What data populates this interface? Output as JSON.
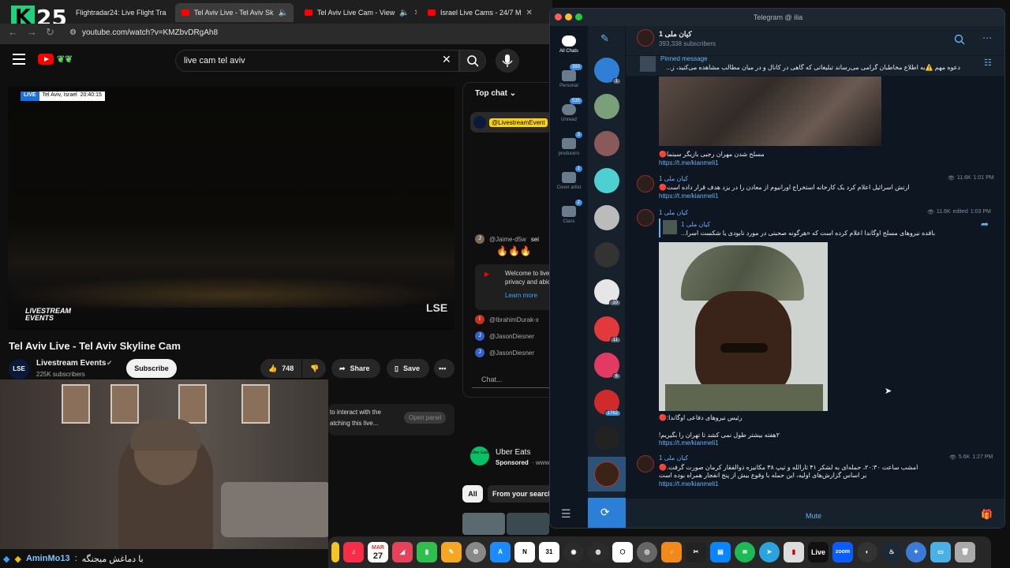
{
  "browser": {
    "counter": {
      "letter": "K",
      "number": "25"
    },
    "tabs": [
      {
        "label": "Flightradar24: Live Flight Tra",
        "active": false
      },
      {
        "label": "Tel Aviv Live - Tel Aviv Sk",
        "active": true
      },
      {
        "label": "Tel Aviv Live Cam - View",
        "active": false
      },
      {
        "label": "Israel Live Cams - 24/7 M",
        "active": false
      }
    ],
    "url": "youtube.com/watch?v=KMZbvDRgAh8"
  },
  "youtube": {
    "search": {
      "value": "live cam tel aviv"
    },
    "live_badge": "LIVE",
    "live_location": "Tel Aviv, Israel",
    "live_time": "20:40:15",
    "video_overlay_logo": "LIVESTREAM EVENTS",
    "video_corner_logo": "LSE",
    "video_title": "Tel Aviv Live - Tel Aviv Skyline Cam",
    "channel": {
      "avatar_text": "LSE",
      "name": "Livestream Events",
      "subscribers": "225K subscribers"
    },
    "subscribe_label": "Subscribe",
    "like_count": "748",
    "share_label": "Share",
    "save_label": "Save",
    "chat": {
      "header": "Top chat",
      "pinned_user": "@LivestreamEvent",
      "messages": [
        {
          "user": "@Jaime-d5w",
          "text": "sei",
          "avatar": "J",
          "color": "#7a6a5a"
        },
        {
          "user": "@IbrahimDurak-x",
          "text": "",
          "avatar": "I",
          "color": "#c2341f"
        },
        {
          "user": "@JasonDiesner",
          "text": "",
          "avatar": "J",
          "color": "#3461c9"
        },
        {
          "user": "@JasonDiesner",
          "text": "",
          "avatar": "J",
          "color": "#3461c9"
        }
      ],
      "welcome_text": "Welcome to live privacy and abic",
      "learn_more": "Learn more",
      "input_placeholder": "Chat...",
      "interact_text_1": "to interact with the",
      "interact_text_2": "atching this live...",
      "open_panel": "Open panel"
    },
    "ad": {
      "title": "Uber Eats",
      "sponsored": "Sponsored",
      "dots": "· www.",
      "logo_text": "Uber Eats"
    },
    "filters": {
      "all": "All",
      "from_search": "From your search"
    }
  },
  "stream_banner": {
    "user": "AminMo13",
    "separator": ":",
    "text": "با دماغش میجنگه"
  },
  "telegram": {
    "window_title": "Telegram @ ilia",
    "folders": [
      {
        "label": "All Chats",
        "badge": ""
      },
      {
        "label": "Personal",
        "badge": "393"
      },
      {
        "label": "Unread",
        "badge": "535"
      },
      {
        "label": "producers",
        "badge": "3"
      },
      {
        "label": "Cover artist",
        "badge": "1"
      },
      {
        "label": "Class",
        "badge": "2"
      }
    ],
    "chat_badges": [
      "1",
      "10",
      "11",
      "6",
      "1762"
    ],
    "channel": {
      "name": "کیان ملی 1",
      "subscribers": "393,338 subscribers"
    },
    "pinned": {
      "label": "Pinned message",
      "text": "دعوه مهم ⚠️به اطلاع مخاطبان گرامی می‌رساند تبلیغاتی که گاهی در کانال و در میان مطالب مشاهده می‌کنید، ز..."
    },
    "messages": [
      {
        "caption": "مسلح شدن مهران رجبی بازیگر سینما🔴",
        "link": "https://t.me/kianmeli1"
      },
      {
        "sender": "کیان ملی 1",
        "text": "ارتش اسرائیل اعلام کرد یک کارخانه استخراج اورانیوم از معادن را در یزد هدف قرار داده است🔴",
        "link": "https://t.me/kianmeli1",
        "views": "11.6K",
        "time": "1:01 PM"
      },
      {
        "sender": "کیان ملی 1",
        "reply_sender": "کیان ملی 1",
        "reply_text": "باقده نیروهای مسلح اوگاندا اعلام کرده است که «هرگونه صحبتی در مورد نابودی یا شکست اسرا...",
        "caption": "رئیس نیروهای دفاعی اوگاندا:🔴",
        "text2": "۲هفته بیشتر طول نمی کشد تا تهران را بگیریم!",
        "link": "https://t.me/kianmeli1",
        "views": "11.6K",
        "edited": "edited",
        "time": "1:03 PM"
      },
      {
        "sender": "کیان ملی 1",
        "text": "امشب ساعت ۲۰:۳۰، حمله‌ای به لشکر ۴۱ ثارالله و تیپ ۳۸ مکانیزه ذوالفقار کرمان صورت گرفت.🔴",
        "text_b": "بر اساس گزارش‌های اولیه، این حمله با وقوع بیش از پنج انفجار همراه بوده است",
        "link": "https://t.me/kianmeli1",
        "views": "5.6K",
        "time": "1:27 PM"
      }
    ],
    "mute_label": "Mute"
  },
  "dock": {
    "calendar_month": "MAR",
    "calendar_day": "27",
    "notion_letter": "N",
    "live_label": "Live",
    "zoom_label": "zoom"
  }
}
